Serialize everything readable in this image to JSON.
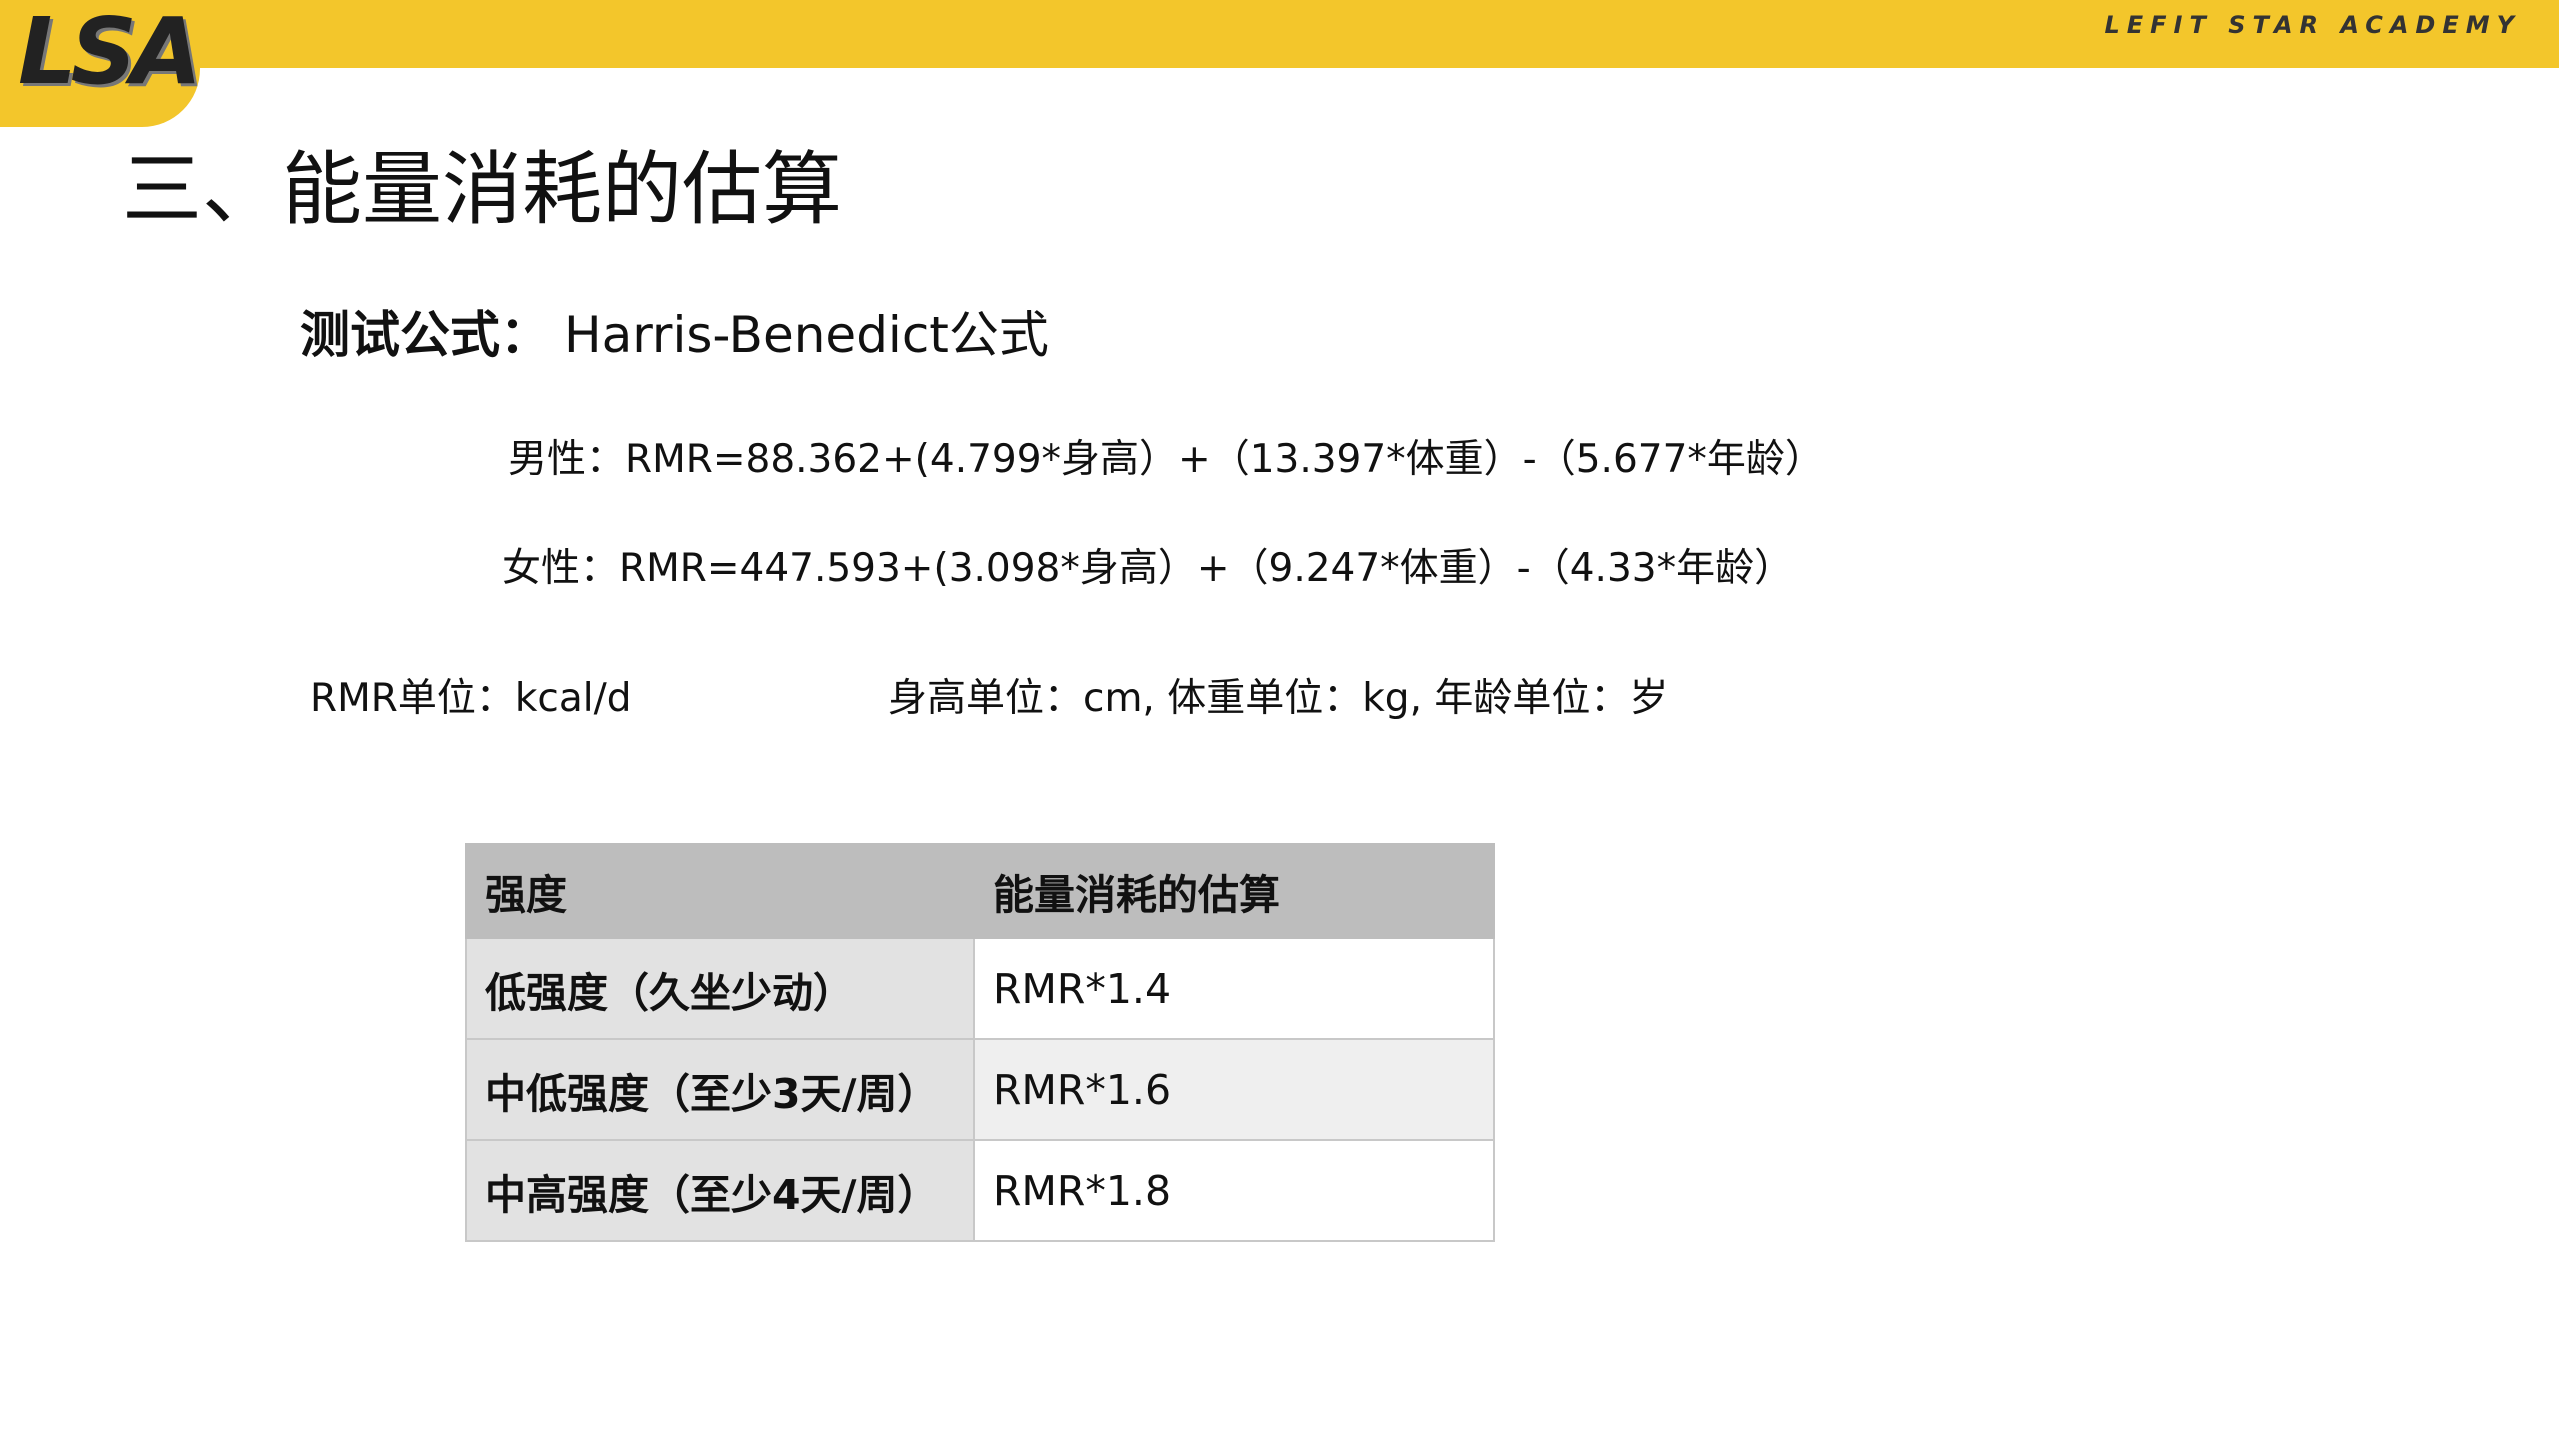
{
  "header": {
    "logo_text": "LSA",
    "brand": "LEFIT STAR ACADEMY",
    "accent_color": "#f3c62b"
  },
  "title": "三、能量消耗的估算",
  "formula": {
    "label": "测试公式：",
    "name": "Harris-Benedict公式",
    "male": "男性：RMR=88.362+(4.799*身高）+（13.397*体重）-（5.677*年龄）",
    "female": "女性：RMR=447.593+(3.098*身高）+（9.247*体重）-（4.33*年龄）"
  },
  "units": {
    "rmr": "RMR单位：kcal/d",
    "body": "身高单位：cm, 体重单位：kg, 年龄单位：岁"
  },
  "table": {
    "headers": [
      "强度",
      "能量消耗的估算"
    ],
    "rows": [
      [
        "低强度（久坐少动）",
        "RMR*1.4"
      ],
      [
        "中低强度（至少3天/周）",
        "RMR*1.6"
      ],
      [
        "中高强度（至少4天/周）",
        "RMR*1.8"
      ]
    ]
  }
}
